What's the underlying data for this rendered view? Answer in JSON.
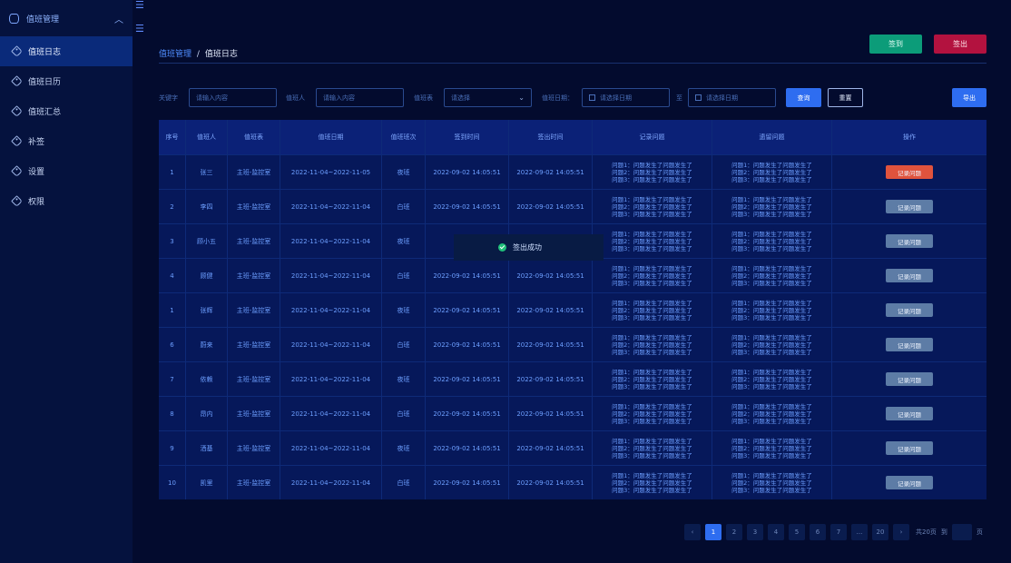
{
  "sidebar": {
    "header": {
      "label": "值班管理"
    },
    "items": [
      {
        "label": "值班日志"
      },
      {
        "label": "值班日历"
      },
      {
        "label": "值班汇总"
      },
      {
        "label": "补签"
      },
      {
        "label": "设置"
      },
      {
        "label": "权限"
      }
    ]
  },
  "breadcrumb": {
    "parent": "值班管理",
    "sep": "/",
    "current": "值班日志"
  },
  "actions": {
    "sign_in": "签到",
    "sign_out": "签出"
  },
  "filters": {
    "keyword_label": "关键字",
    "keyword_placeholder": "请输入内容",
    "person_label": "值班人",
    "person_placeholder": "请输入内容",
    "table_label": "值班表",
    "table_placeholder": "请选择",
    "date_label": "值班日期：",
    "date_start_placeholder": "请选择日期",
    "to_label": "至",
    "date_end_placeholder": "请选择日期",
    "query": "查询",
    "reset": "重置",
    "export": "导出"
  },
  "table": {
    "columns": [
      "序号",
      "值班人",
      "值班表",
      "值班日期",
      "值班班次",
      "签到时间",
      "签出时间",
      "记录问题",
      "遗留问题",
      "操作"
    ],
    "rows": [
      {
        "no": "1",
        "person": "张三",
        "table": "主班-监控室",
        "date": "2022-11-04~2022-11-05",
        "shift": "夜班",
        "in": "2022-09-02 14:05:51",
        "out": "2022-09-02 14:05:51",
        "rec": [
          "问题1：问题发生了问题发生了",
          "问题2：问题发生了问题发生了",
          "问题3：问题发生了问题发生了"
        ],
        "left": [
          "问题1：问题发生了问题发生了",
          "问题2：问题发生了问题发生了",
          "问题3：问题发生了问题发生了"
        ],
        "action": "记录问题"
      },
      {
        "no": "2",
        "person": "李四",
        "table": "主班-监控室",
        "date": "2022-11-04~2022-11-04",
        "shift": "白班",
        "in": "2022-09-02 14:05:51",
        "out": "2022-09-02 14:05:51",
        "rec": [
          "问题1：问题发生了问题发生了",
          "问题2：问题发生了问题发生了",
          "问题3：问题发生了问题发生了"
        ],
        "left": [
          "问题1：问题发生了问题发生了",
          "问题2：问题发生了问题发生了",
          "问题3：问题发生了问题发生了"
        ],
        "action": "记录问题"
      },
      {
        "no": "3",
        "person": "顾小五",
        "table": "主班-监控室",
        "date": "2022-11-04~2022-11-04",
        "shift": "夜班",
        "in": "2022-",
        "out": "",
        "rec": [
          "问题1：问题发生了问题发生了",
          "问题2：问题发生了问题发生了",
          "问题3：问题发生了问题发生了"
        ],
        "left": [
          "问题1：问题发生了问题发生了",
          "问题2：问题发生了问题发生了",
          "问题3：问题发生了问题发生了"
        ],
        "action": "记录问题"
      },
      {
        "no": "4",
        "person": "顾健",
        "table": "主班-监控室",
        "date": "2022-11-04~2022-11-04",
        "shift": "白班",
        "in": "2022-09-02 14:05:51",
        "out": "2022-09-02 14:05:51",
        "rec": [
          "问题1：问题发生了问题发生了",
          "问题2：问题发生了问题发生了",
          "问题3：问题发生了问题发生了"
        ],
        "left": [
          "问题1：问题发生了问题发生了",
          "问题2：问题发生了问题发生了",
          "问题3：问题发生了问题发生了"
        ],
        "action": "记录问题"
      },
      {
        "no": "1",
        "person": "张辉",
        "table": "主班-监控室",
        "date": "2022-11-04~2022-11-04",
        "shift": "夜班",
        "in": "2022-09-02 14:05:51",
        "out": "2022-09-02 14:05:51",
        "rec": [
          "问题1：问题发生了问题发生了",
          "问题2：问题发生了问题发生了",
          "问题3：问题发生了问题发生了"
        ],
        "left": [
          "问题1：问题发生了问题发生了",
          "问题2：问题发生了问题发生了",
          "问题3：问题发生了问题发生了"
        ],
        "action": "记录问题"
      },
      {
        "no": "6",
        "person": "蔚来",
        "table": "主班-监控室",
        "date": "2022-11-04~2022-11-04",
        "shift": "白班",
        "in": "2022-09-02 14:05:51",
        "out": "2022-09-02 14:05:51",
        "rec": [
          "问题1：问题发生了问题发生了",
          "问题2：问题发生了问题发生了",
          "问题3：问题发生了问题发生了"
        ],
        "left": [
          "问题1：问题发生了问题发生了",
          "问题2：问题发生了问题发生了",
          "问题3：问题发生了问题发生了"
        ],
        "action": "记录问题"
      },
      {
        "no": "7",
        "person": "依赖",
        "table": "主班-监控室",
        "date": "2022-11-04~2022-11-04",
        "shift": "夜班",
        "in": "2022-09-02 14:05:51",
        "out": "2022-09-02 14:05:51",
        "rec": [
          "问题1：问题发生了问题发生了",
          "问题2：问题发生了问题发生了",
          "问题3：问题发生了问题发生了"
        ],
        "left": [
          "问题1：问题发生了问题发生了",
          "问题2：问题发生了问题发生了",
          "问题3：问题发生了问题发生了"
        ],
        "action": "记录问题"
      },
      {
        "no": "8",
        "person": "昂内",
        "table": "主班-监控室",
        "date": "2022-11-04~2022-11-04",
        "shift": "白班",
        "in": "2022-09-02 14:05:51",
        "out": "2022-09-02 14:05:51",
        "rec": [
          "问题1：问题发生了问题发生了",
          "问题2：问题发生了问题发生了",
          "问题3：问题发生了问题发生了"
        ],
        "left": [
          "问题1：问题发生了问题发生了",
          "问题2：问题发生了问题发生了",
          "问题3：问题发生了问题发生了"
        ],
        "action": "记录问题"
      },
      {
        "no": "9",
        "person": "洒基",
        "table": "主班-监控室",
        "date": "2022-11-04~2022-11-04",
        "shift": "夜班",
        "in": "2022-09-02 14:05:51",
        "out": "2022-09-02 14:05:51",
        "rec": [
          "问题1：问题发生了问题发生了",
          "问题2：问题发生了问题发生了",
          "问题3：问题发生了问题发生了"
        ],
        "left": [
          "问题1：问题发生了问题发生了",
          "问题2：问题发生了问题发生了",
          "问题3：问题发生了问题发生了"
        ],
        "action": "记录问题"
      },
      {
        "no": "10",
        "person": "凯里",
        "table": "主班-监控室",
        "date": "2022-11-04~2022-11-04",
        "shift": "白班",
        "in": "2022-09-02 14:05:51",
        "out": "2022-09-02 14:05:51",
        "rec": [
          "问题1：问题发生了问题发生了",
          "问题2：问题发生了问题发生了",
          "问题3：问题发生了问题发生了"
        ],
        "left": [
          "问题1：问题发生了问题发生了",
          "问题2：问题发生了问题发生了",
          "问题3：问题发生了问题发生了"
        ],
        "action": "记录问题"
      }
    ]
  },
  "toast": {
    "text": "签出成功"
  },
  "pagination": {
    "prev": "‹",
    "pages": [
      "1",
      "2",
      "3",
      "4",
      "5",
      "6",
      "7",
      "...",
      "20"
    ],
    "next": "›",
    "total": "共20页",
    "jump_label": "到",
    "page_suffix": "页"
  }
}
